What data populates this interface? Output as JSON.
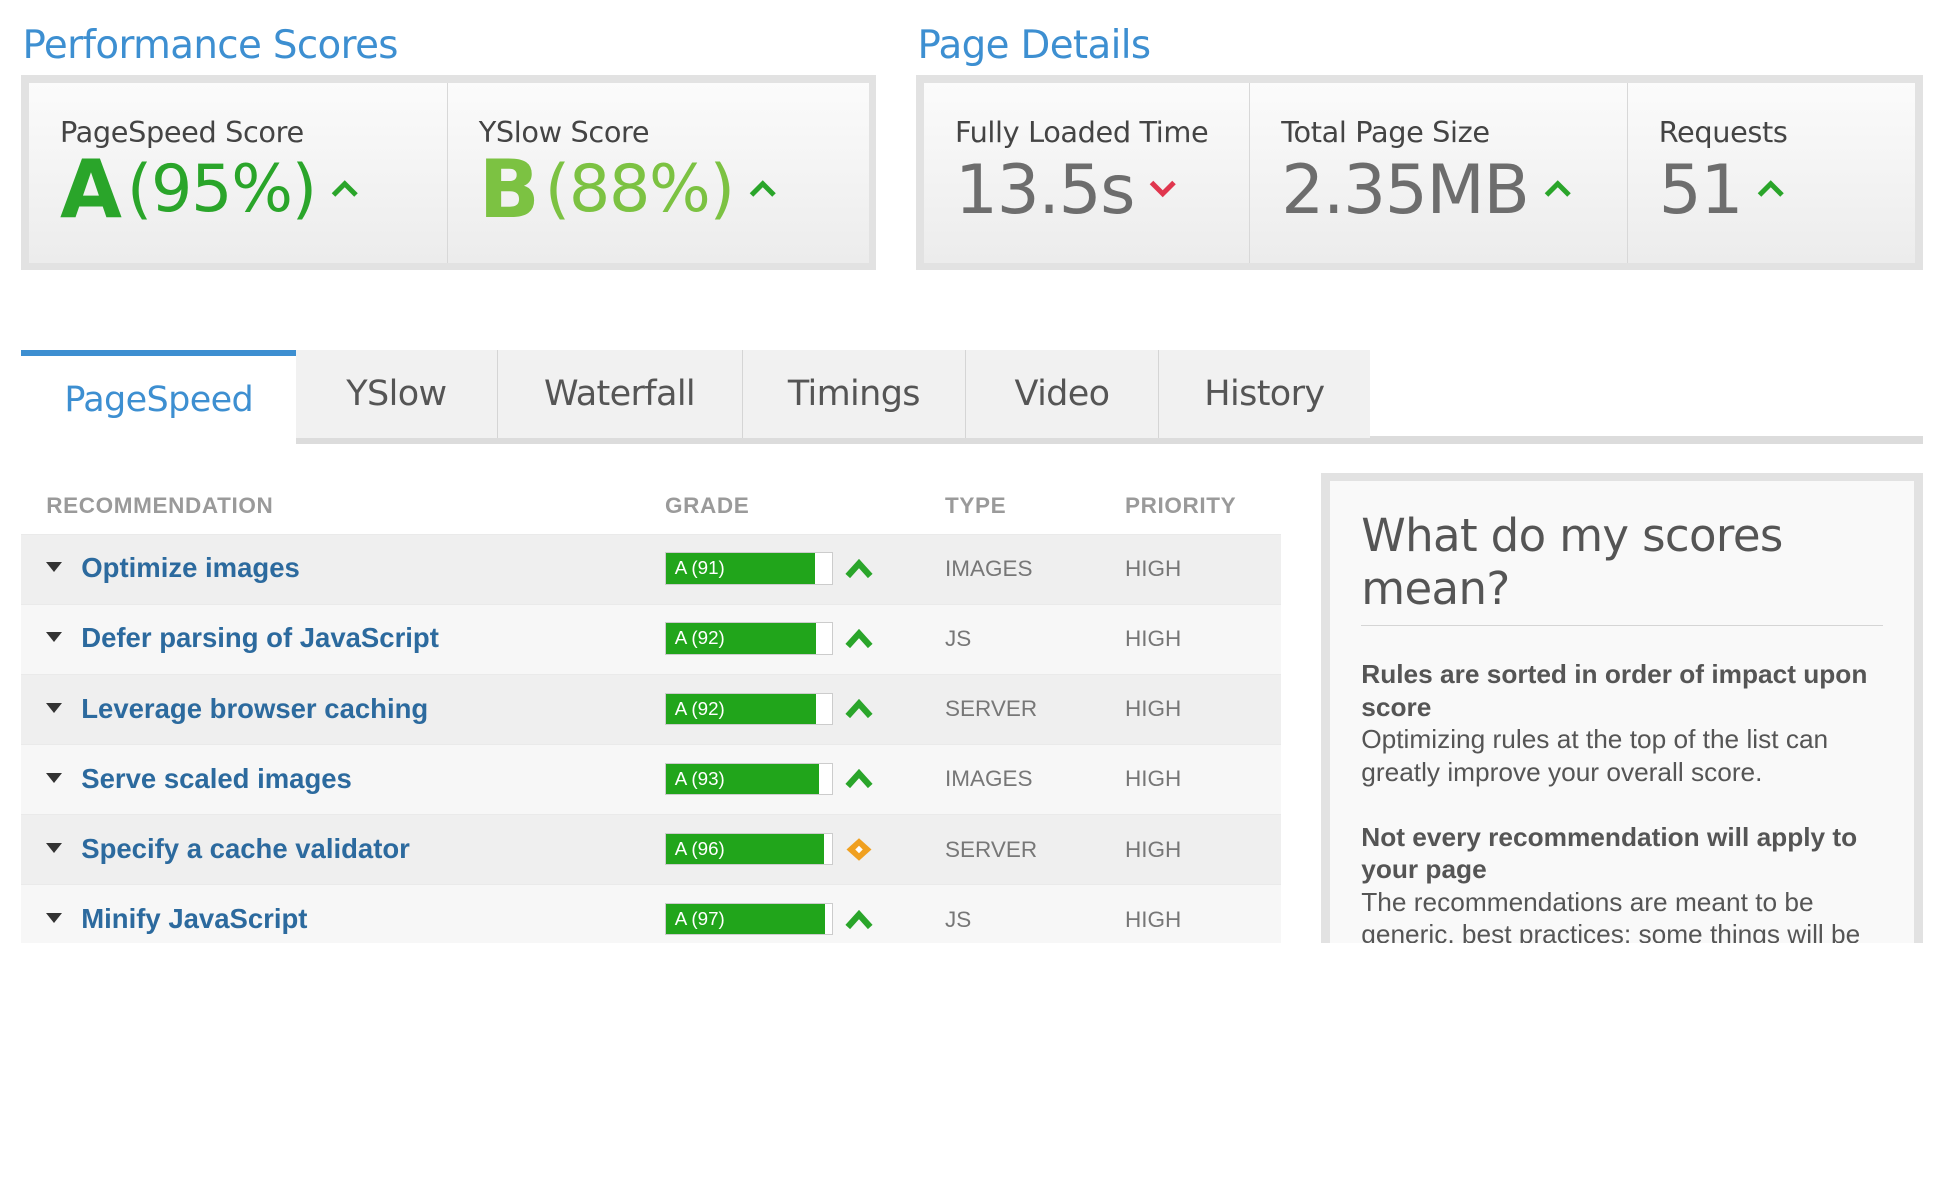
{
  "performance": {
    "title": "Performance Scores",
    "pagespeed": {
      "label": "PageSpeed Score",
      "grade": "A",
      "pct": "(95%)",
      "trend": "up"
    },
    "yslow": {
      "label": "YSlow Score",
      "grade": "B",
      "pct": "(88%)",
      "trend": "up"
    }
  },
  "details": {
    "title": "Page Details",
    "loaded": {
      "label": "Fully Loaded Time",
      "value": "13.5s",
      "trend": "down"
    },
    "size": {
      "label": "Total Page Size",
      "value": "2.35MB",
      "trend": "up"
    },
    "requests": {
      "label": "Requests",
      "value": "51",
      "trend": "up"
    }
  },
  "colors": {
    "accent": "#3d8fd1",
    "grade_a": "#2aa52a",
    "grade_b": "#7cc242",
    "bar": "#21a51b",
    "up": "#2aa52a",
    "down": "#e0364e",
    "warn": "#f0a020"
  },
  "tabs": [
    {
      "label": "PageSpeed",
      "active": true
    },
    {
      "label": "YSlow"
    },
    {
      "label": "Waterfall"
    },
    {
      "label": "Timings"
    },
    {
      "label": "Video"
    },
    {
      "label": "History"
    }
  ],
  "table": {
    "headers": {
      "recommendation": "RECOMMENDATION",
      "grade": "GRADE",
      "type": "TYPE",
      "priority": "PRIORITY"
    },
    "rows": [
      {
        "rec": "Optimize images",
        "grade": "A (91)",
        "score": 91,
        "icon": "up-arrow-icon",
        "type": "IMAGES",
        "priority": "HIGH"
      },
      {
        "rec": "Defer parsing of JavaScript",
        "grade": "A (92)",
        "score": 92,
        "icon": "up-arrow-icon",
        "type": "JS",
        "priority": "HIGH"
      },
      {
        "rec": "Leverage browser caching",
        "grade": "A (92)",
        "score": 92,
        "icon": "up-arrow-icon",
        "type": "SERVER",
        "priority": "HIGH"
      },
      {
        "rec": "Serve scaled images",
        "grade": "A (93)",
        "score": 93,
        "icon": "up-arrow-icon",
        "type": "IMAGES",
        "priority": "HIGH"
      },
      {
        "rec": "Specify a cache validator",
        "grade": "A (96)",
        "score": 96,
        "icon": "diamond-icon",
        "type": "SERVER",
        "priority": "HIGH"
      },
      {
        "rec": "Minify JavaScript",
        "grade": "A (97)",
        "score": 97,
        "icon": "up-arrow-icon",
        "type": "JS",
        "priority": "HIGH"
      }
    ]
  },
  "sidebar": {
    "title": "What do my scores mean?",
    "h1": "Rules are sorted in order of impact upon score",
    "p1": "Optimizing rules at the top of the list can greatly improve your overall score.",
    "h2": "Not every recommendation will apply to your page",
    "p2": "The recommendations are meant to be generic, best practices; some things will be out of your control (eg. external resources) or may not apply to your page."
  }
}
